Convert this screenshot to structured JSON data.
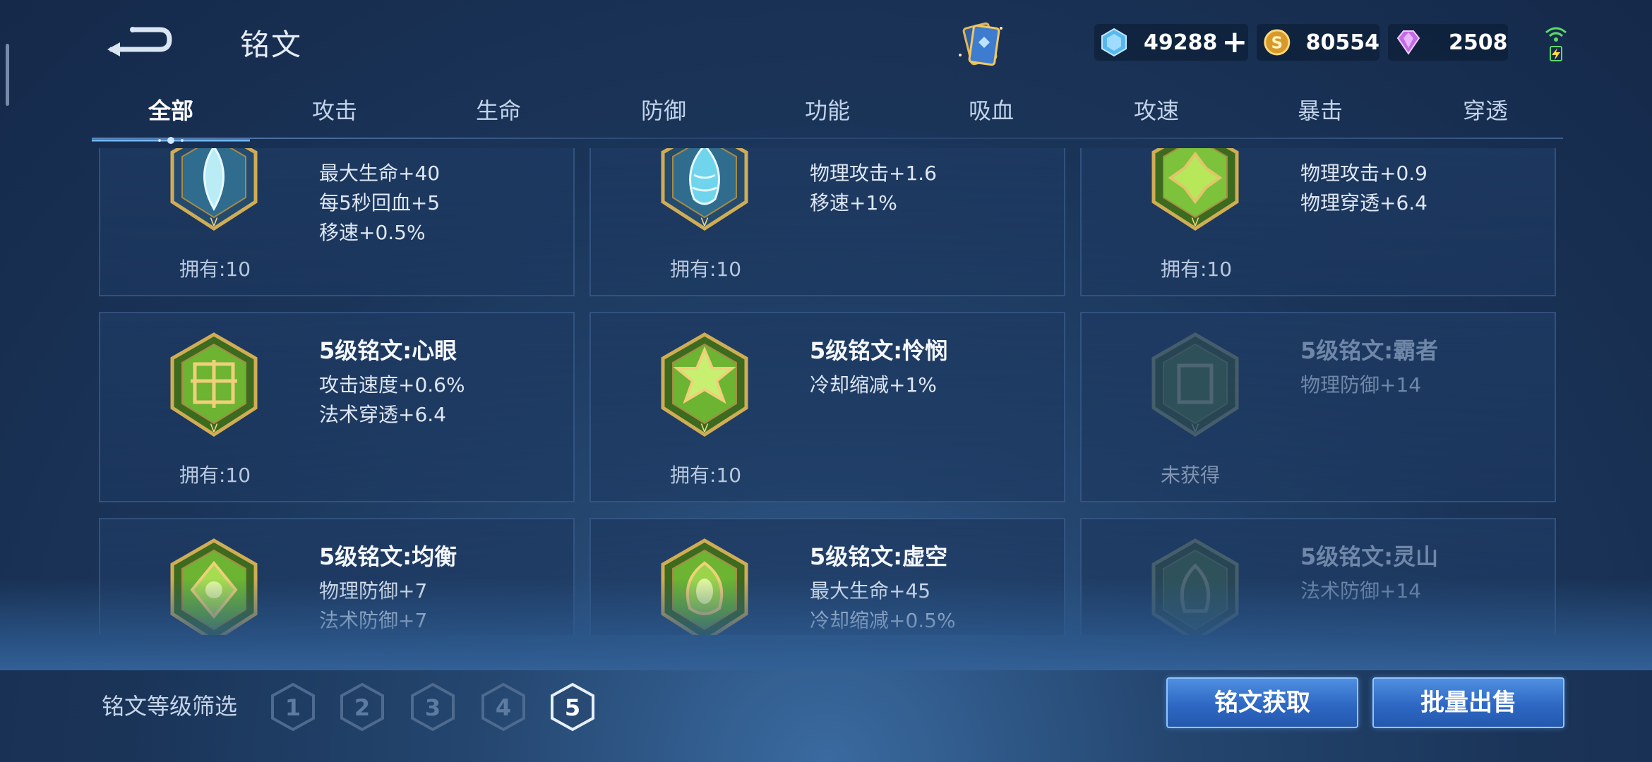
{
  "header": {
    "title": "铭文",
    "currencies": [
      {
        "icon": "diamond-icon",
        "value": "49288"
      },
      {
        "icon": "gold-coin-icon",
        "value": "80554"
      },
      {
        "icon": "purple-crystal-icon",
        "value": "2508"
      }
    ],
    "add_label": "+"
  },
  "tabs": [
    "全部",
    "攻击",
    "生命",
    "防御",
    "功能",
    "吸血",
    "攻速",
    "暴击",
    "穿透"
  ],
  "active_tab": "全部",
  "cards": [
    {
      "name": "",
      "stats": [
        "最大生命+40",
        "每5秒回血+5",
        "移速+0.5%"
      ],
      "owned": "拥有:10",
      "gem": "teal-drop-gem-icon"
    },
    {
      "name": "",
      "stats": [
        "物理攻击+1.6",
        "移速+1%"
      ],
      "owned": "拥有:10",
      "gem": "teal-flame-gem-icon"
    },
    {
      "name": "",
      "stats": [
        "物理攻击+0.9",
        "物理穿透+6.4"
      ],
      "owned": "拥有:10",
      "gem": "green-cross-gem-icon"
    },
    {
      "name": "5级铭文:心眼",
      "stats": [
        "攻击速度+0.6%",
        "法术穿透+6.4"
      ],
      "owned": "拥有:10",
      "gem": "green-hexagon-gem-icon"
    },
    {
      "name": "5级铭文:怜悯",
      "stats": [
        "冷却缩减+1%"
      ],
      "owned": "拥有:10",
      "gem": "green-star-gem-icon"
    },
    {
      "name": "5级铭文:霸者",
      "stats": [
        "物理防御+14"
      ],
      "owned": "未获得",
      "gem": "locked-gem-icon",
      "locked": true
    },
    {
      "name": "5级铭文:均衡",
      "stats": [
        "物理防御+7",
        "法术防御+7"
      ],
      "owned": "",
      "gem": "green-diamond-gem-icon"
    },
    {
      "name": "5级铭文:虚空",
      "stats": [
        "最大生命+45",
        "冷却缩减+0.5%"
      ],
      "owned": "",
      "gem": "green-void-gem-icon"
    },
    {
      "name": "5级铭文:灵山",
      "stats": [
        "法术防御+14"
      ],
      "owned": "",
      "gem": "locked-gem-icon",
      "locked": true
    }
  ],
  "footer": {
    "filter_label": "铭文等级筛选",
    "levels": [
      "1",
      "2",
      "3",
      "4",
      "5"
    ],
    "selected_level": "5",
    "obtain_button": "铭文获取",
    "batch_sell_button": "批量出售"
  },
  "colors": {
    "accent_blue": "#2e68c4",
    "active_tab": "#ffffff",
    "gem_green": "#5fa832",
    "gem_gold": "#c9a544"
  }
}
